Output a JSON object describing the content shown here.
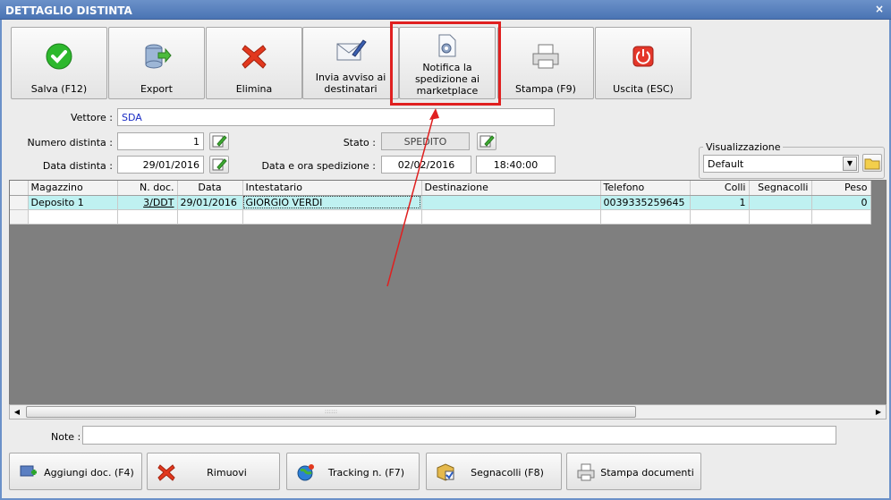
{
  "window": {
    "title": "DETTAGLIO DISTINTA",
    "close_glyph": "×"
  },
  "toolbar": {
    "save": "Salva (F12)",
    "export": "Export",
    "delete": "Elimina",
    "notify_recipients": "Invia avviso ai destinatari",
    "notify_marketplace": "Notifica la spedizione ai marketplace",
    "print": "Stampa (F9)",
    "exit": "Uscita (ESC)"
  },
  "form": {
    "carrier_label": "Vettore :",
    "carrier_value": "SDA",
    "number_label": "Numero distinta :",
    "number_value": "1",
    "date_label": "Data distinta :",
    "date_value": "29/01/2016",
    "status_label": "Stato :",
    "status_value": "SPEDITO",
    "ship_datetime_label": "Data e ora spedizione :",
    "ship_date_value": "02/02/2016",
    "ship_time_value": "18:40:00"
  },
  "view": {
    "group_label": "Visualizzazione",
    "selected": "Default"
  },
  "grid": {
    "columns": [
      "Magazzino",
      "N. doc.",
      "Data",
      "Intestatario",
      "Destinazione",
      "Telefono",
      "Colli",
      "Segnacolli",
      "Peso"
    ],
    "rows": [
      {
        "magazzino": "Deposito 1",
        "n_doc": "3/DDT",
        "data": "29/01/2016",
        "intestatario": "GIORGIO VERDI",
        "destinazione": "",
        "telefono": "0039335259645",
        "colli": "1",
        "segnacolli": "",
        "peso": "0"
      }
    ],
    "scroll_grip": "::::::"
  },
  "note": {
    "label": "Note :",
    "value": ""
  },
  "bottom": {
    "add_doc": "Aggiungi doc. (F4)",
    "remove": "Rimuovi",
    "tracking": "Tracking n. (F7)",
    "labels": "Segnacolli (F8)",
    "print_docs": "Stampa documenti"
  },
  "colors": {
    "titlebar": "#5580c0",
    "selection_row": "#bff1f1",
    "highlight": "#e02020",
    "arrow": "#e02020"
  }
}
